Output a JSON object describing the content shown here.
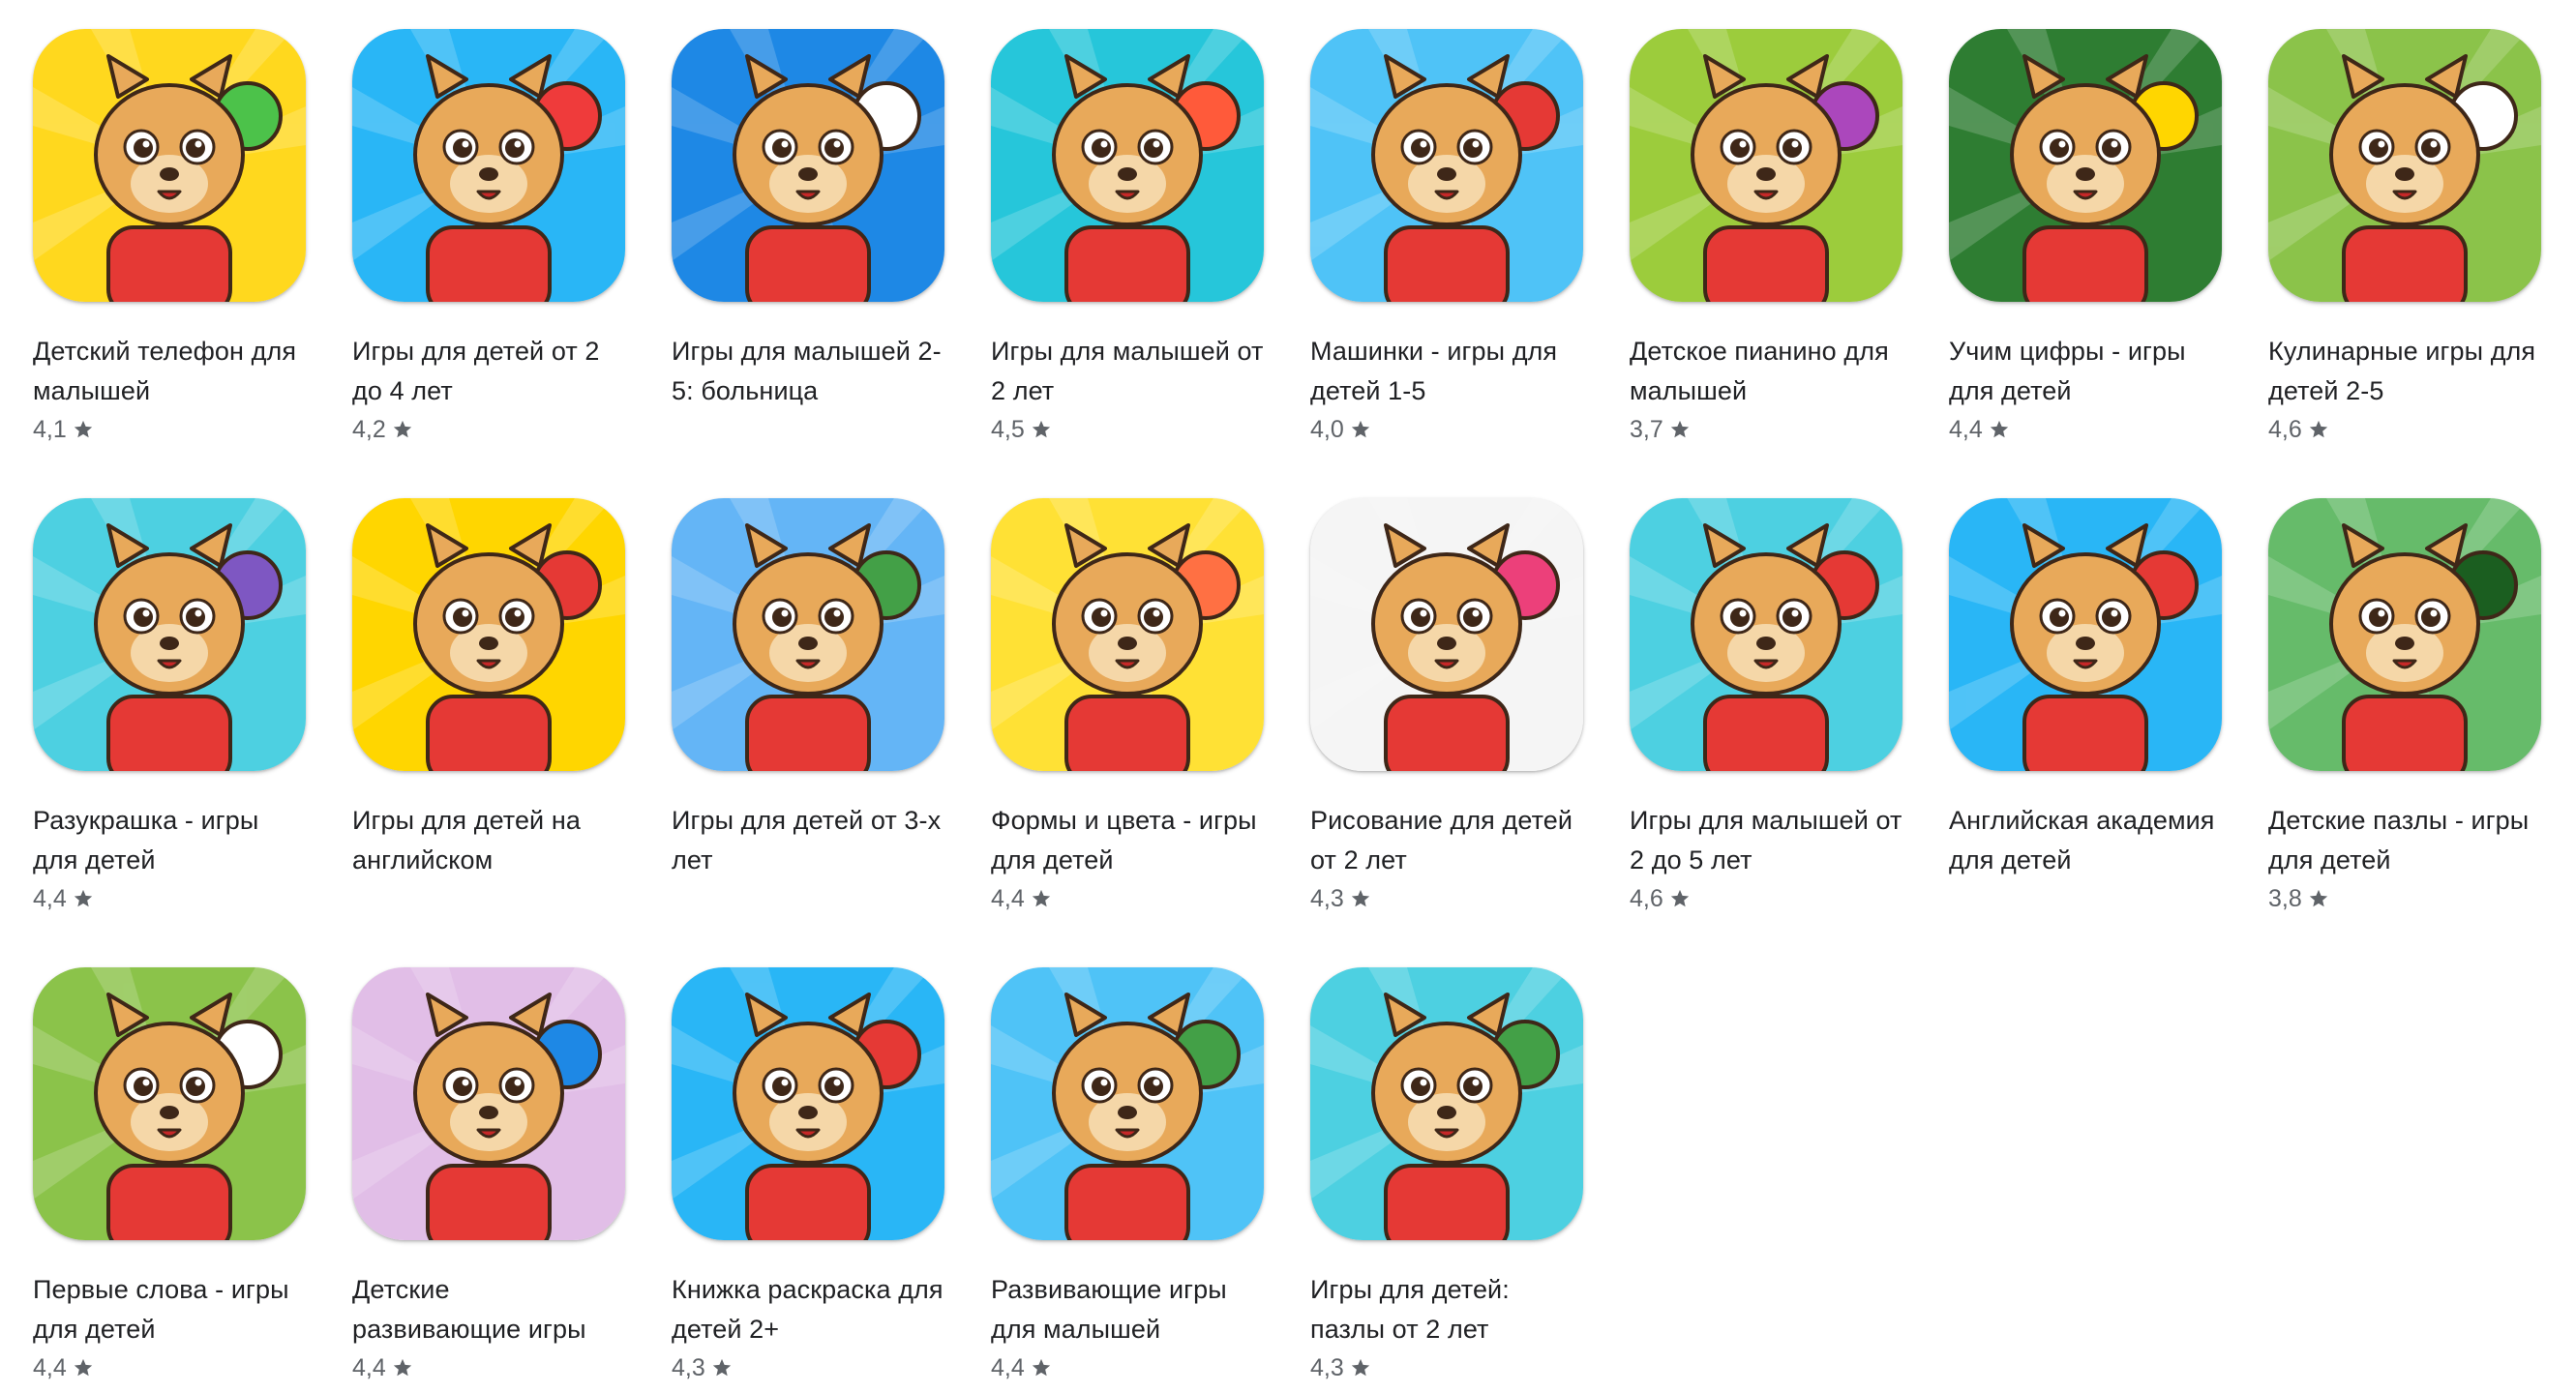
{
  "apps": [
    {
      "title": "Детский телефон для малышей",
      "rating": "4,1",
      "bg": "#ffd81e",
      "accent": "#4cc24a",
      "prop": "phone-icon"
    },
    {
      "title": "Игры для детей от 2 до 4 лет",
      "rating": "4,2",
      "bg": "#29b6f6",
      "accent": "#ef3b3b",
      "prop": "balloons-icon"
    },
    {
      "title": "Игры для малышей 2-5: больница",
      "rating": "",
      "bg": "#1e88e5",
      "accent": "#ffffff",
      "prop": "doctor-icon"
    },
    {
      "title": "Игры для малышей от 2 лет",
      "rating": "4,5",
      "bg": "#26c6da",
      "accent": "#ff5a3a",
      "prop": "shapes-toy-icon"
    },
    {
      "title": "Машинки - игры для детей 1-5",
      "rating": "4,0",
      "bg": "#4fc3f7",
      "accent": "#e53935",
      "prop": "car-icon"
    },
    {
      "title": "Детское пианино для малышей",
      "rating": "3,7",
      "bg": "#9ccc3c",
      "accent": "#ab47bc",
      "prop": "piano-icon"
    },
    {
      "title": "Учим цифры - игры для детей",
      "rating": "4,4",
      "bg": "#2e7d32",
      "accent": "#ffd600",
      "prop": "numbers-icon"
    },
    {
      "title": "Кулинарные игры для детей 2-5",
      "rating": "4,6",
      "bg": "#8bc34a",
      "accent": "#ffffff",
      "prop": "burger-icon"
    },
    {
      "title": "Разукрашка - игры для детей",
      "rating": "4,4",
      "bg": "#4dd0e1",
      "accent": "#7e57c2",
      "prop": "pencils-icon"
    },
    {
      "title": "Игры для детей на английском",
      "rating": "",
      "bg": "#ffd600",
      "accent": "#e53935",
      "prop": "play-icon"
    },
    {
      "title": "Игры для детей от 3-х лет",
      "rating": "",
      "bg": "#64b5f6",
      "accent": "#43a047",
      "prop": "globe-icon"
    },
    {
      "title": "Формы и цвета - игры для детей",
      "rating": "4,4",
      "bg": "#ffe135",
      "accent": "#ff7043",
      "prop": "stacking-rings-icon"
    },
    {
      "title": "Рисование для детей от 2 лет",
      "rating": "4,3",
      "bg": "#f5f5f5",
      "accent": "#ec407a",
      "prop": "crayons-icon"
    },
    {
      "title": "Игры для малышей от 2 до 5 лет",
      "rating": "4,6",
      "bg": "#4dd0e1",
      "accent": "#e53935",
      "prop": "cube-icon"
    },
    {
      "title": "Английская академия для детей",
      "rating": "",
      "bg": "#29b6f6",
      "accent": "#e53935",
      "prop": "abc-icon"
    },
    {
      "title": "Детские пазлы - игры для детей",
      "rating": "3,8",
      "bg": "#66bb6a",
      "accent": "#1b5e20",
      "prop": "puzzle-icon"
    },
    {
      "title": "Первые слова - игры для детей",
      "rating": "4,4",
      "bg": "#8bc34a",
      "accent": "#ffffff",
      "prop": "cards-icon"
    },
    {
      "title": "Детские развивающие игры",
      "rating": "4,4",
      "bg": "#e1bee7",
      "accent": "#1e88e5",
      "prop": "clothes-icon"
    },
    {
      "title": "Книжка раскраска для детей 2+",
      "rating": "4,3",
      "bg": "#29b6f6",
      "accent": "#e53935",
      "prop": "palette-icon"
    },
    {
      "title": "Развивающие игры для малышей",
      "rating": "4,4",
      "bg": "#4fc3f7",
      "accent": "#43a047",
      "prop": "world-ball-icon"
    },
    {
      "title": "Игры для детей: пазлы от 2 лет",
      "rating": "4,3",
      "bg": "#4dd0e1",
      "accent": "#43a047",
      "prop": "chameleon-icon"
    }
  ],
  "colors": {
    "bear_fur": "#e8a95a",
    "bear_face": "#f5d7a8",
    "bear_outline": "#3e2718",
    "shirt": "#e53935",
    "star": "#5f6368"
  }
}
